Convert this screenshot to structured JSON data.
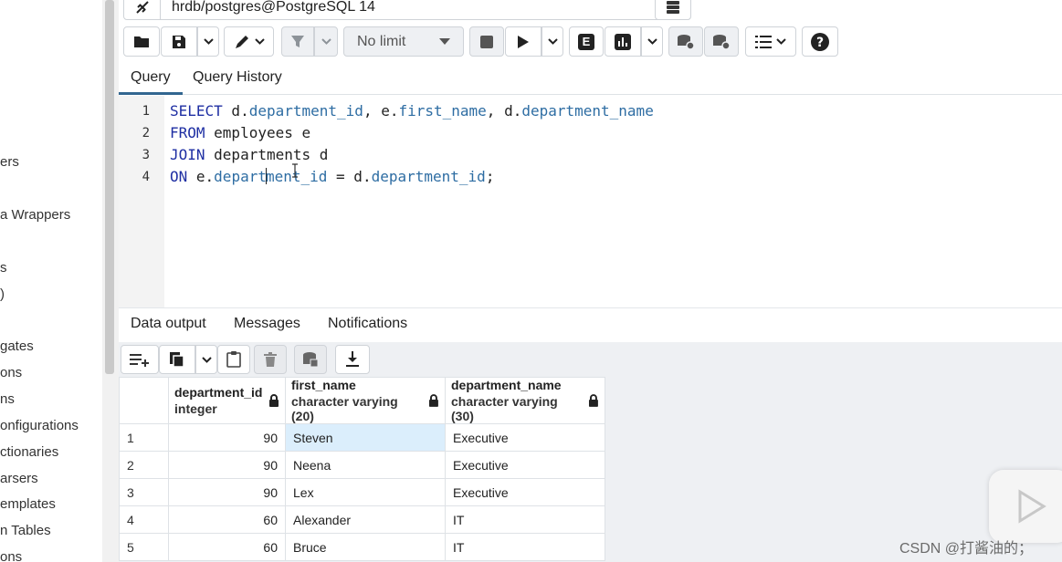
{
  "left_tree": {
    "items": [
      "ers",
      "a Wrappers",
      "s",
      ")",
      "gates",
      "ons",
      "ns",
      "onfigurations",
      "ctionaries",
      "arsers",
      "emplates",
      "n Tables",
      "ons"
    ]
  },
  "connection": {
    "label": "hrdb/postgres@PostgreSQL 14"
  },
  "toolbar": {
    "limit_label": "No limit",
    "explain_label": "E"
  },
  "query_tabs": {
    "query": "Query",
    "history": "Query History"
  },
  "editor": {
    "line_numbers": [
      "1",
      "2",
      "3",
      "4"
    ],
    "lines": {
      "l1": {
        "kw": "SELECT",
        "a": " d.",
        "b": "department_id",
        "c": ", e.",
        "d": "first_name",
        "e": ", d.",
        "f": "department_name"
      },
      "l2": {
        "kw": "FROM",
        "rest": " employees e"
      },
      "l3": {
        "kw": "JOIN",
        "rest": " departments d"
      },
      "l4": {
        "kw": "ON",
        "a": " e.",
        "b1": "depart",
        "b2": "ment_id",
        "c": " = d.",
        "d": "department_id",
        "e": ";"
      }
    }
  },
  "result_tabs": {
    "data_output": "Data output",
    "messages": "Messages",
    "notifications": "Notifications"
  },
  "grid": {
    "columns": [
      {
        "name": "department_id",
        "type": "integer"
      },
      {
        "name": "first_name",
        "type": "character varying (20)"
      },
      {
        "name": "department_name",
        "type": "character varying (30)"
      }
    ],
    "rows": [
      {
        "n": "1",
        "department_id": "90",
        "first_name": "Steven",
        "department_name": "Executive"
      },
      {
        "n": "2",
        "department_id": "90",
        "first_name": "Neena",
        "department_name": "Executive"
      },
      {
        "n": "3",
        "department_id": "90",
        "first_name": "Lex",
        "department_name": "Executive"
      },
      {
        "n": "4",
        "department_id": "60",
        "first_name": "Alexander",
        "department_name": "IT"
      },
      {
        "n": "5",
        "department_id": "60",
        "first_name": "Bruce",
        "department_name": "IT"
      }
    ]
  },
  "watermark": "CSDN @打酱油的；"
}
